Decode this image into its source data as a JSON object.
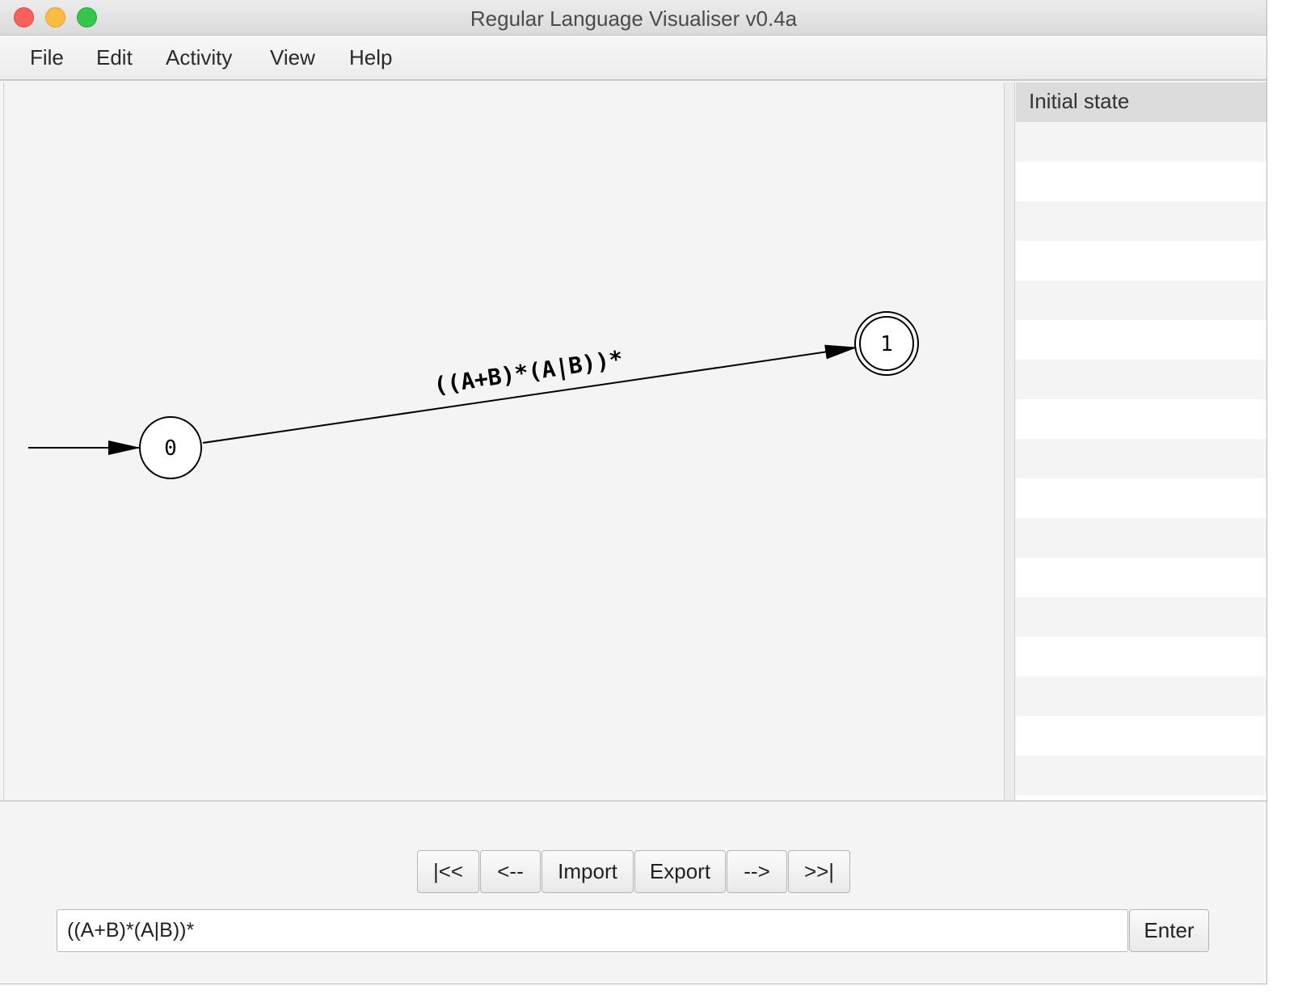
{
  "window": {
    "title": "Regular Language Visualiser v0.4a"
  },
  "menu": {
    "items": [
      "File",
      "Edit",
      "Activity",
      "View",
      "Help"
    ]
  },
  "automaton": {
    "states": [
      {
        "id": "0",
        "initial": true,
        "accepting": false
      },
      {
        "id": "1",
        "initial": false,
        "accepting": true
      }
    ],
    "transitions": [
      {
        "from": "0",
        "to": "1",
        "label": "((A+B)*(A|B))*"
      }
    ]
  },
  "side_panel": {
    "header": "Initial state"
  },
  "controls": {
    "first": "|<<",
    "prev": "<--",
    "import": "Import",
    "export": "Export",
    "next": "-->",
    "last": ">>|"
  },
  "input": {
    "value": "((A+B)*(A|B))*",
    "enter_label": "Enter"
  },
  "colors": {
    "close": "#fc605c",
    "minimize": "#fdbc40",
    "maximize": "#34c84a"
  }
}
